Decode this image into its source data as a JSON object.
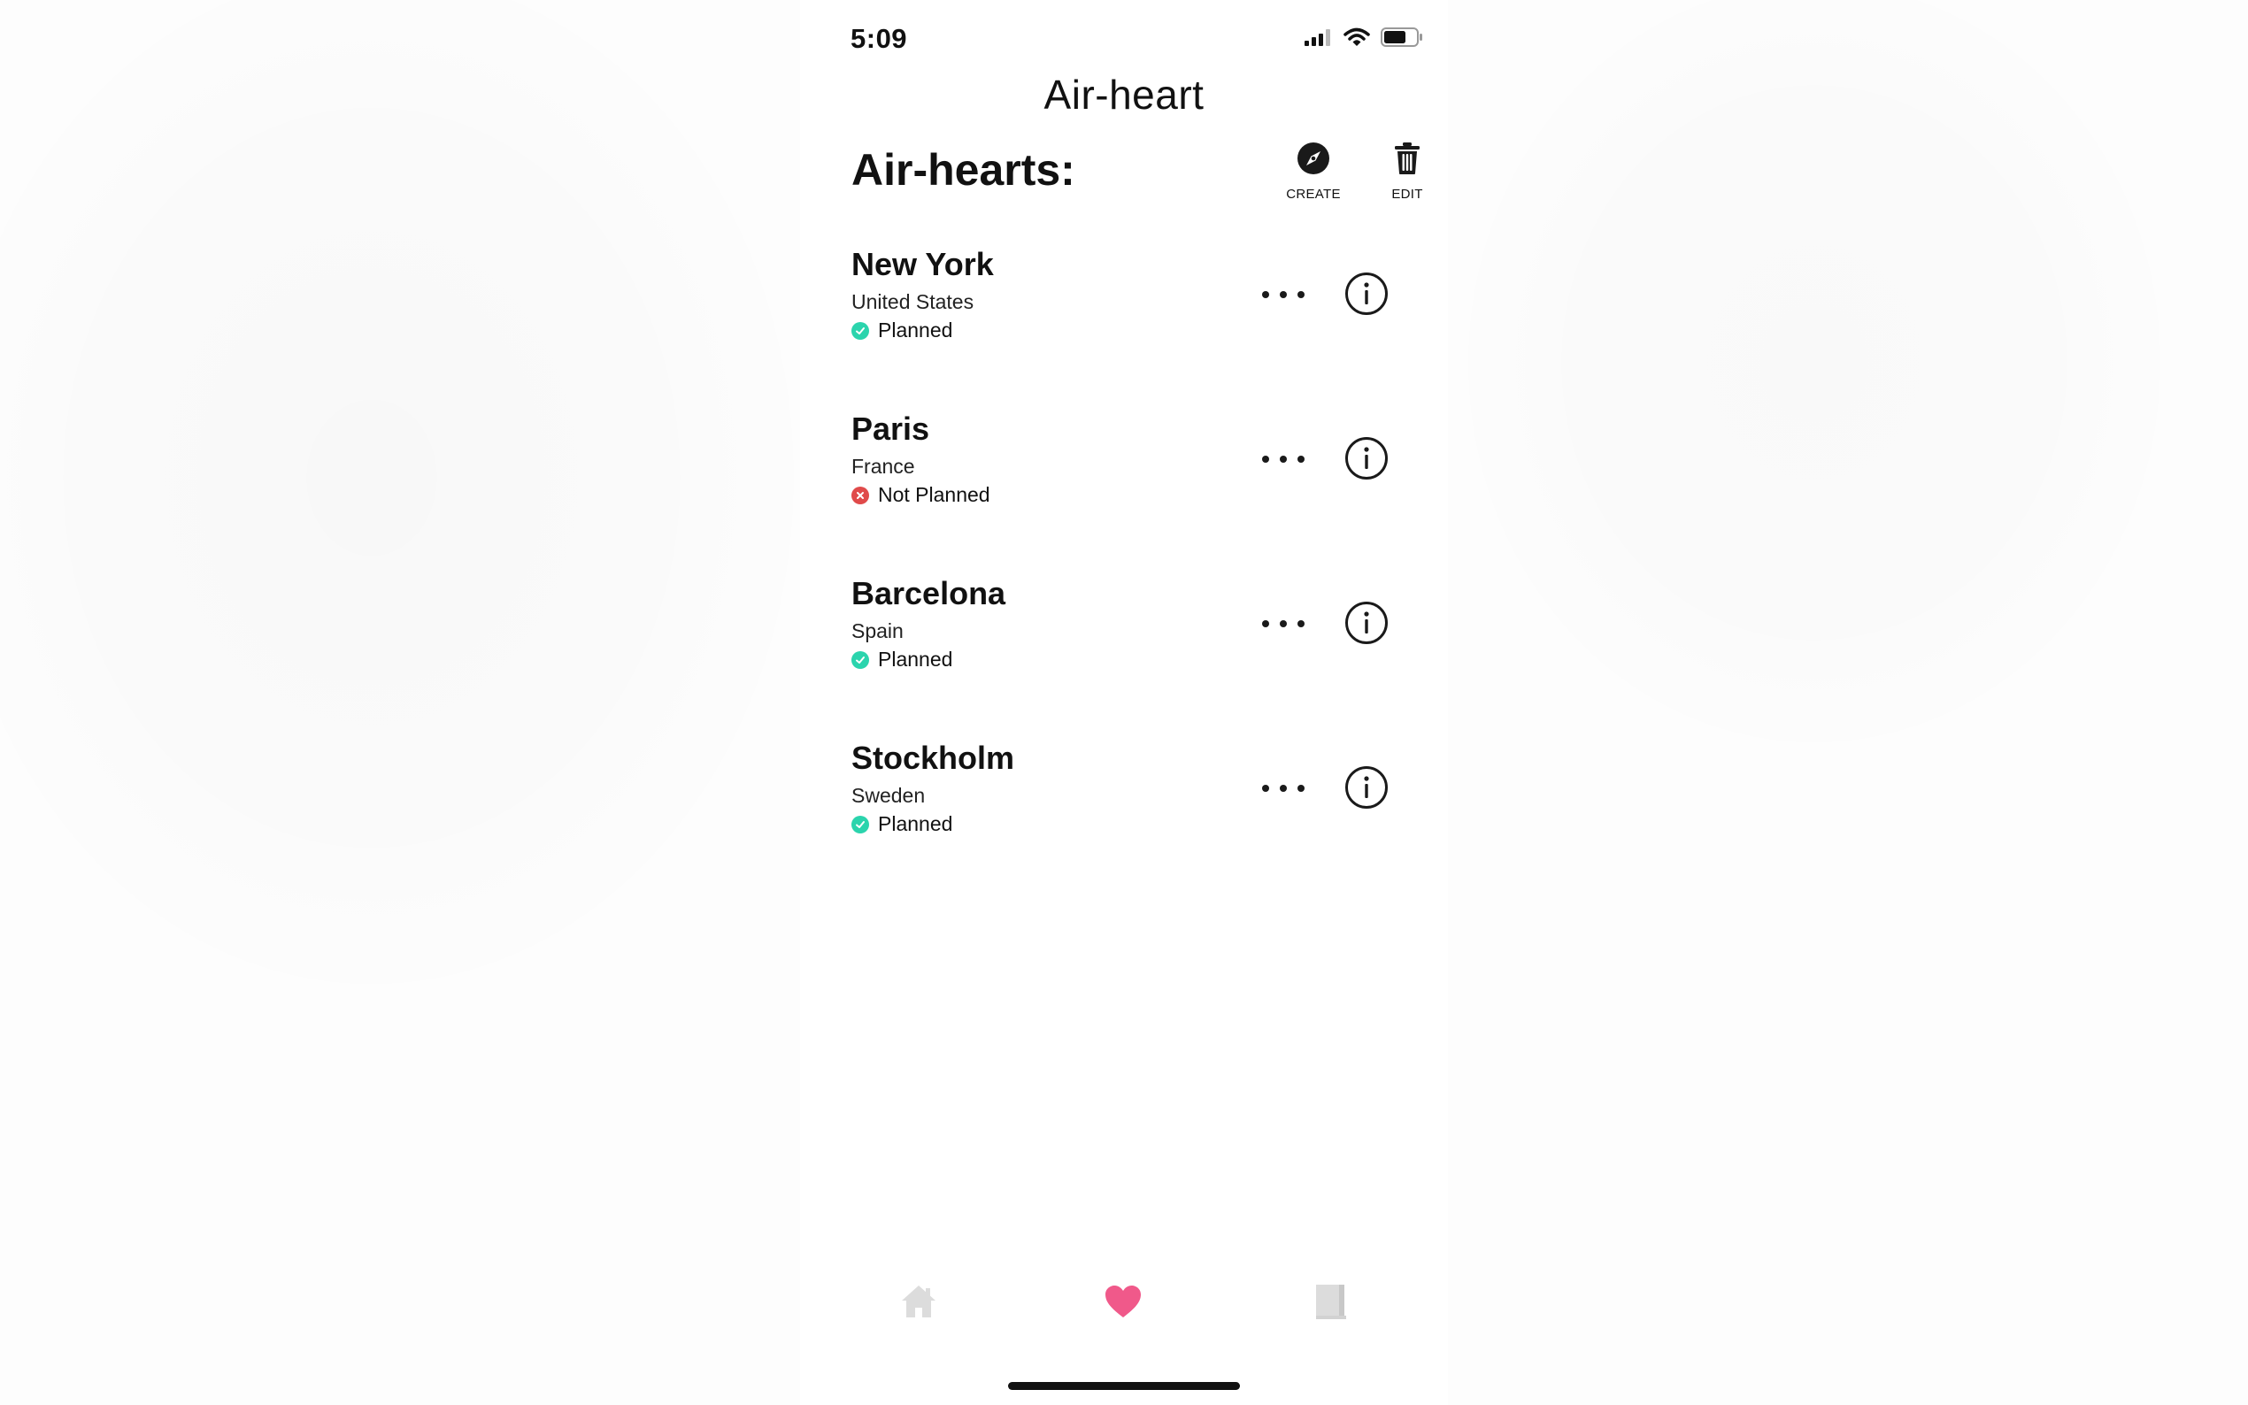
{
  "status_bar": {
    "time": "5:09",
    "icons": [
      "cellular-signal-icon",
      "wifi-icon",
      "battery-icon"
    ]
  },
  "header": {
    "app_title": "Air-heart",
    "section_title": "Air-hearts:",
    "create_label": "CREATE",
    "edit_label": "EDIT",
    "create_icon": "compass-icon",
    "edit_icon": "trash-icon"
  },
  "list": {
    "items": [
      {
        "city": "New York",
        "country": "United States",
        "status": "Planned",
        "planned": true
      },
      {
        "city": "Paris",
        "country": "France",
        "status": "Not Planned",
        "planned": false
      },
      {
        "city": "Barcelona",
        "country": "Spain",
        "status": "Planned",
        "planned": true
      },
      {
        "city": "Stockholm",
        "country": "Sweden",
        "status": "Planned",
        "planned": true
      }
    ],
    "row_icons": [
      "more-icon",
      "info-icon"
    ]
  },
  "tabbar": {
    "tabs": [
      {
        "name": "home",
        "icon": "home-icon",
        "active": false
      },
      {
        "name": "favorites",
        "icon": "heart-icon",
        "active": true
      },
      {
        "name": "bookmarks",
        "icon": "book-icon",
        "active": false
      }
    ]
  },
  "colors": {
    "planned": "#2bd4ad",
    "not_planned": "#e04a4a",
    "active_tab": "#f0598a",
    "inactive_tab": "#dcdcdc",
    "text": "#111111"
  }
}
